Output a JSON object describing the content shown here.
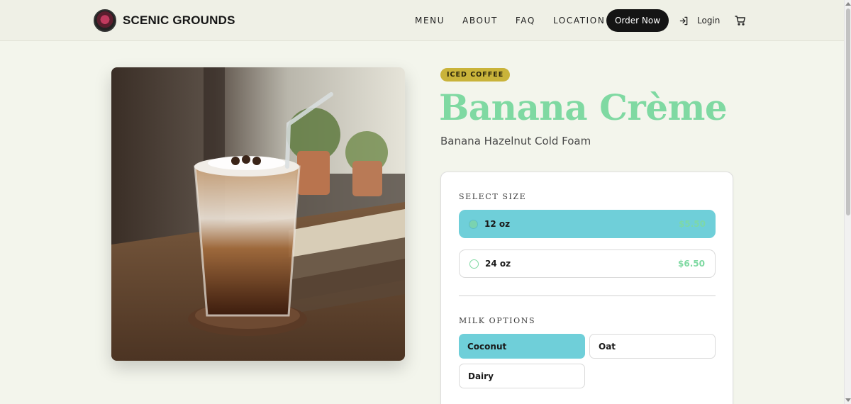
{
  "header": {
    "brand": "SCENIC GROUNDS",
    "nav": [
      "MENU",
      "ABOUT",
      "FAQ",
      "LOCATION"
    ],
    "order_button": "Order Now",
    "login": "Login"
  },
  "product": {
    "badge": "ICED COFFEE",
    "title": "Banana Crème",
    "subtitle": "Banana Hazelnut Cold Foam",
    "size_label": "SELECT SIZE",
    "sizes": [
      {
        "name": "12 oz",
        "price": "$5.50",
        "selected": true
      },
      {
        "name": "24 oz",
        "price": "$6.50",
        "selected": false
      }
    ],
    "milk_label": "MILK OPTIONS",
    "milk_options": [
      {
        "name": "Coconut",
        "selected": true
      },
      {
        "name": "Oat",
        "selected": false
      },
      {
        "name": "Dairy",
        "selected": false
      }
    ]
  },
  "colors": {
    "accent_green": "#7fd9a2",
    "selected_teal": "#6fcfd9",
    "badge_gold": "#c9b33a",
    "button_dark": "#141414",
    "background": "#f3f5ec"
  },
  "icons": [
    "login-icon",
    "cart-icon",
    "logo-icon",
    "radio-icon"
  ]
}
